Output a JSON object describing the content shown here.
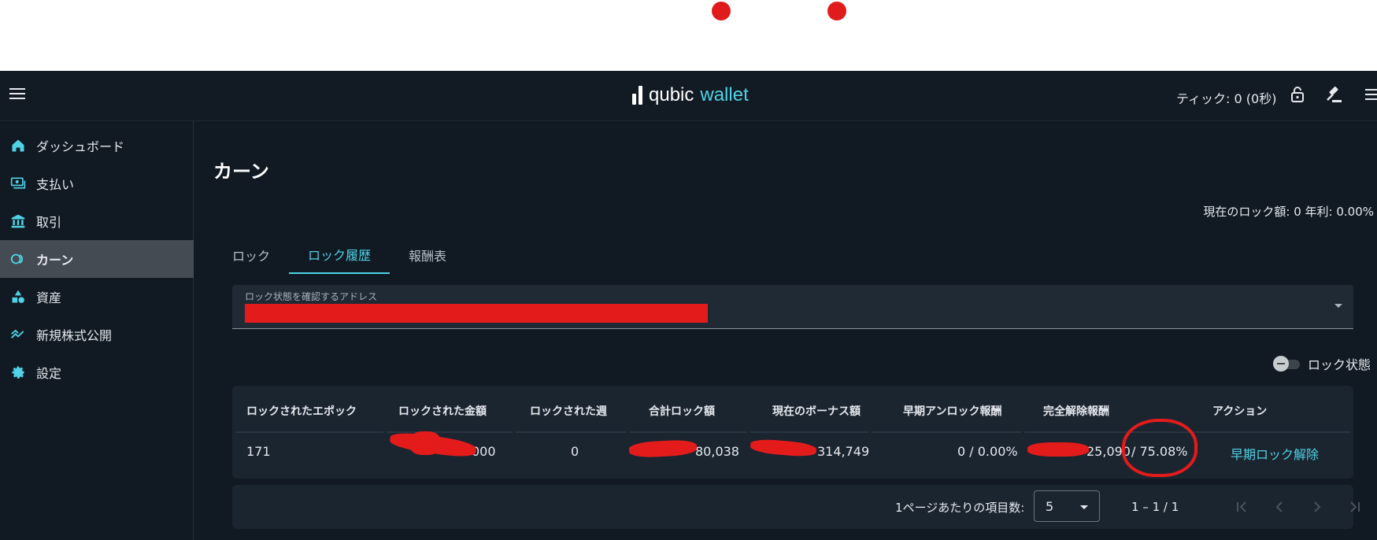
{
  "header": {
    "logo_primary": "qubic",
    "logo_secondary": "wallet",
    "tick_text": "ティック: 0 (0秒)"
  },
  "sidebar": {
    "items": [
      {
        "label": "ダッシュボード",
        "icon": "home-icon"
      },
      {
        "label": "支払い",
        "icon": "payments-icon"
      },
      {
        "label": "取引",
        "icon": "bank-icon"
      },
      {
        "label": "カーン",
        "icon": "earn-icon",
        "active": true
      },
      {
        "label": "資産",
        "icon": "assets-icon"
      },
      {
        "label": "新規株式公開",
        "icon": "ipo-icon"
      },
      {
        "label": "設定",
        "icon": "settings-icon"
      }
    ]
  },
  "main": {
    "title": "カーン",
    "lock_summary": "現在のロック額: 0  年利: 0.00%",
    "tabs": [
      {
        "label": "ロック"
      },
      {
        "label": "ロック履歴",
        "active": true
      },
      {
        "label": "報酬表"
      }
    ],
    "address_field": {
      "label": "ロック状態を確認するアドレス"
    },
    "toggle_label": "ロック状態",
    "table": {
      "headers": [
        "ロックされたエポック",
        "ロックされた金額",
        "ロックされた週",
        "合計ロック額",
        "現在のボーナス額",
        "早期アンロック報酬",
        "完全解除報酬",
        "アクション"
      ],
      "row": {
        "epoch": "171",
        "amount": "000",
        "weeks": "0",
        "total": "80,038",
        "bonus": "314,749",
        "early_reward": "0 / 0.00%",
        "full_reward_amount": "25,090",
        "full_reward_pct": "/ 75.08%",
        "action": "早期ロック解除"
      }
    },
    "pager": {
      "items_per_page_label": "1ページあたりの項目数:",
      "items_per_page_value": "5",
      "range": "1 – 1 / 1"
    }
  },
  "colors": {
    "accent": "#4fd2e6",
    "background": "#111a23",
    "card": "#1b2530",
    "redaction": "#e31b1b"
  }
}
